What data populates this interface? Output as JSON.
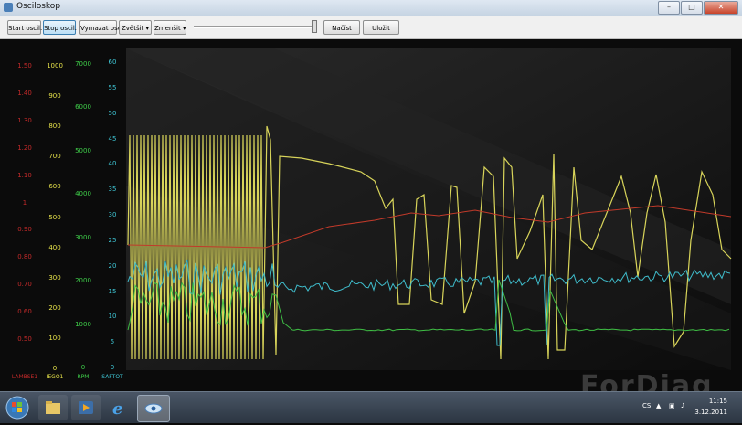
{
  "window": {
    "title": "Osciloskop"
  },
  "toolbar": {
    "start": "Start oscil.",
    "stop": "Stop oscil.",
    "clear": "Vymazat oscil.",
    "zoom_in": "Zvětšit",
    "zoom_out": "Zmenšit",
    "load": "Načíst",
    "save": "Uložit"
  },
  "scales": {
    "lambda": {
      "label": "LAMBSE1",
      "color": "#c42a2a",
      "ticks": [
        "1.50",
        "1.40",
        "1.30",
        "1.20",
        "1.10",
        "1",
        "0.90",
        "0.80",
        "0.70",
        "0.60",
        "0.50"
      ]
    },
    "iego": {
      "label": "IEGO1",
      "color": "#e6e24a",
      "ticks": [
        "1000",
        "900",
        "800",
        "700",
        "600",
        "500",
        "400",
        "300",
        "200",
        "100",
        "0"
      ]
    },
    "rpm": {
      "label": "RPM",
      "color": "#3fcf4a",
      "ticks": [
        "7000",
        "6000",
        "5000",
        "4000",
        "3000",
        "2000",
        "1000",
        "0"
      ]
    },
    "saftot": {
      "label": "SAFTOT",
      "color": "#3fc7d6",
      "ticks": [
        "60",
        "55",
        "50",
        "45",
        "40",
        "35",
        "30",
        "25",
        "20",
        "15",
        "10",
        "5",
        "0"
      ]
    }
  },
  "taskbar": {
    "time": "11:15",
    "date": "3.12.2011",
    "lang": "CS"
  },
  "watermark": "ForDiag"
}
